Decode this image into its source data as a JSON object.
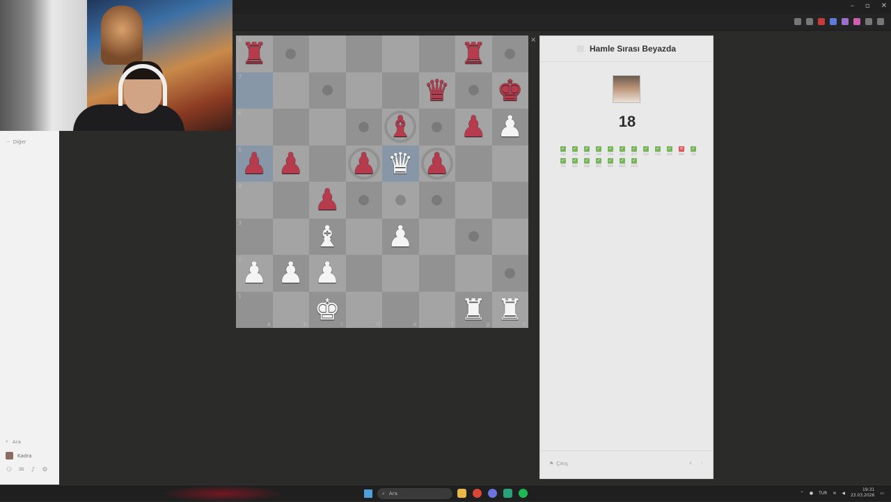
{
  "window": {
    "minimize": "–",
    "maximize": "▫",
    "close": "✕"
  },
  "sidebar": {
    "more_label": "Diğer",
    "search_label": "Ara",
    "profile_label": "Kadra"
  },
  "board": {
    "close": "×",
    "squares": [
      [
        "r",
        "",
        "",
        "",
        "",
        "",
        "r",
        ""
      ],
      [
        "",
        "",
        "",
        "",
        "",
        "q",
        "",
        "k"
      ],
      [
        "",
        "",
        "",
        "",
        "b",
        "",
        "p",
        "P"
      ],
      [
        "p",
        "p",
        "",
        "p",
        "Q",
        "p",
        "",
        ""
      ],
      [
        "",
        "",
        "p",
        "",
        "",
        "",
        "",
        ""
      ],
      [
        "",
        "",
        "B",
        "",
        "P",
        "",
        "",
        ""
      ],
      [
        "P",
        "P",
        "P",
        "",
        "",
        "",
        "",
        ""
      ],
      [
        "",
        "",
        "K",
        "",
        "",
        "",
        "R",
        "R"
      ]
    ],
    "highlight": [
      "a7",
      "a5",
      "e5"
    ],
    "dots": [
      "b8",
      "h8",
      "c7",
      "g7",
      "d6",
      "f6",
      "d4",
      "e4",
      "f4",
      "g3",
      "h2"
    ],
    "rings": [
      "e6",
      "d5",
      "f5"
    ],
    "ranks": [
      "8",
      "7",
      "6",
      "5",
      "4",
      "3",
      "2",
      "1"
    ],
    "files": [
      "a",
      "b",
      "c",
      "d",
      "e",
      "f",
      "g",
      "h"
    ]
  },
  "panel": {
    "title": "Hamle Sırası Beyazda",
    "score": "18",
    "results": [
      {
        "ok": true,
        "n": "180"
      },
      {
        "ok": true,
        "n": "220"
      },
      {
        "ok": true,
        "n": "249"
      },
      {
        "ok": true,
        "n": "328"
      },
      {
        "ok": true,
        "n": "374"
      },
      {
        "ok": true,
        "n": "402"
      },
      {
        "ok": true,
        "n": "417"
      },
      {
        "ok": true,
        "n": "522"
      },
      {
        "ok": true,
        "n": "576"
      },
      {
        "ok": true,
        "n": "644"
      },
      {
        "ok": false,
        "n": "689"
      },
      {
        "ok": true,
        "n": "730"
      },
      {
        "ok": true,
        "n": "765"
      },
      {
        "ok": true,
        "n": "826"
      },
      {
        "ok": true,
        "n": "858"
      },
      {
        "ok": true,
        "n": "892"
      },
      {
        "ok": true,
        "n": "964"
      },
      {
        "ok": true,
        "n": "1001"
      },
      {
        "ok": true,
        "n": "1070"
      }
    ],
    "exit_label": "Çıkış",
    "prev": "‹",
    "next": "›"
  },
  "taskbar": {
    "search_label": "Ara",
    "lang": "TUR",
    "time": "19:31",
    "date": "23.03.2026"
  },
  "colors": {
    "white_piece": "#f4f4f4",
    "black_piece": "#b53b4d",
    "success": "#77b45a",
    "fail": "#e0555a"
  }
}
